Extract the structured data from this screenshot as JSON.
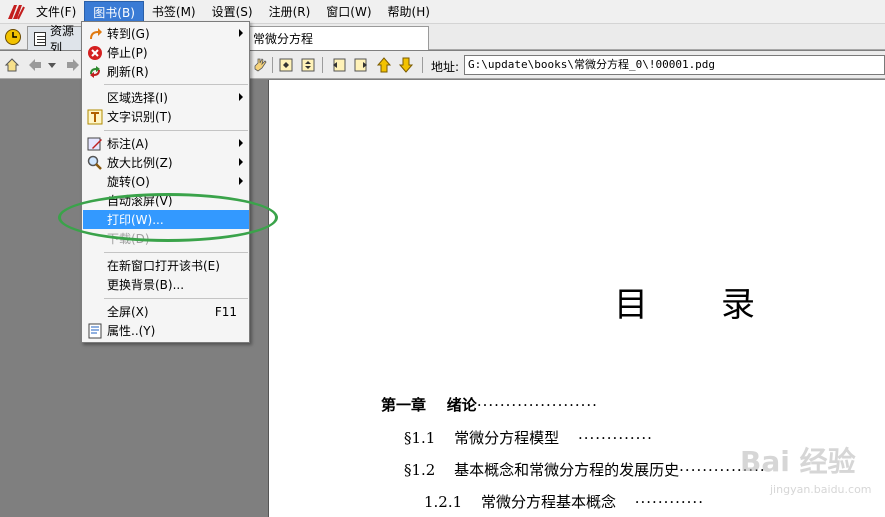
{
  "menubar": {
    "items": [
      {
        "label": "文件(F)",
        "active": false
      },
      {
        "label": "图书(B)",
        "active": true
      },
      {
        "label": "书签(M)",
        "active": false
      },
      {
        "label": "设置(S)",
        "active": false
      },
      {
        "label": "注册(R)",
        "active": false
      },
      {
        "label": "窗口(W)",
        "active": false
      },
      {
        "label": "帮助(H)",
        "active": false
      }
    ]
  },
  "tabs": [
    {
      "label": "资源列",
      "icon": "list-icon"
    },
    {
      "label": "常微分方程",
      "icon": ""
    }
  ],
  "toolbar": {
    "address_label": "地址:",
    "address_value": "G:\\update\\books\\常微分方程_0\\!00001.pdg"
  },
  "dropdown": {
    "items": [
      {
        "label": "转到(G)",
        "icon": "goto-arrow-icon",
        "submenu": true
      },
      {
        "label": "停止(P)",
        "icon": "stop-icon"
      },
      {
        "label": "刷新(R)",
        "icon": "refresh-icon"
      },
      {
        "label": "区域选择(I)",
        "icon": "",
        "submenu": true
      },
      {
        "label": "文字识别(T)",
        "icon": "text-recognize-icon"
      },
      {
        "label": "标注(A)",
        "icon": "annotate-icon",
        "submenu": true
      },
      {
        "label": "放大比例(Z)",
        "icon": "zoom-icon",
        "submenu": true
      },
      {
        "label": "旋转(O)",
        "icon": "",
        "submenu": true
      },
      {
        "label": "自动滚屏(V)",
        "icon": ""
      },
      {
        "label": "打印(W)...",
        "icon": "",
        "selected": true
      },
      {
        "label": "下载(D)",
        "icon": "",
        "disabled": true
      },
      {
        "label": "在新窗口打开该书(E)",
        "icon": ""
      },
      {
        "label": "更换背景(B)...",
        "icon": ""
      },
      {
        "label": "全屏(X)",
        "icon": "",
        "shortcut": "F11"
      },
      {
        "label": "属性..(Y)",
        "icon": "properties-icon"
      }
    ]
  },
  "document": {
    "title_left": "目",
    "title_right": "录",
    "toc": [
      {
        "num": "第一章",
        "text": "绪论",
        "dots": "·····················"
      },
      {
        "num": "§1.1",
        "text": "常微分方程模型",
        "dots": "·············"
      },
      {
        "num": "§1.2",
        "text": "基本概念和常微分方程的发展历史",
        "dots": "···············"
      },
      {
        "num": "1.2.1",
        "text": "常微分方程基本概念",
        "dots": "············"
      }
    ]
  },
  "watermark": {
    "text": "Bai 经验",
    "url": "jingyan.baidu.com"
  }
}
